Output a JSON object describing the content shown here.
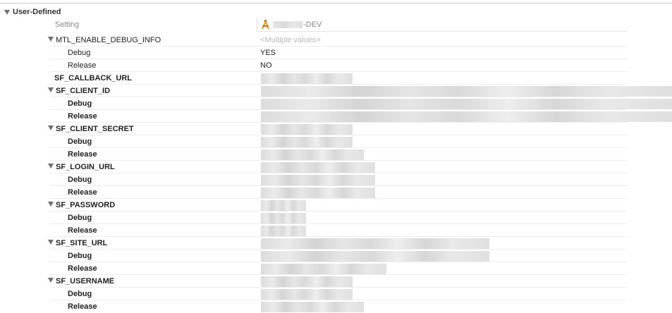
{
  "section": {
    "title": "User-Defined"
  },
  "header": {
    "setting_label": "Setting",
    "target_suffix": "-DEV"
  },
  "rows": [
    {
      "label": "MTL_ENABLE_DEBUG_INFO",
      "value": "<Multiple values>",
      "placeholder": true
    },
    {
      "label": "Debug",
      "value": "YES"
    },
    {
      "label": "Release",
      "value": "NO"
    },
    {
      "label": "SF_CALLBACK_URL"
    },
    {
      "label": "SF_CLIENT_ID"
    },
    {
      "label": "Debug"
    },
    {
      "label": "Release"
    },
    {
      "label": "SF_CLIENT_SECRET"
    },
    {
      "label": "Debug"
    },
    {
      "label": "Release"
    },
    {
      "label": "SF_LOGIN_URL"
    },
    {
      "label": "Debug"
    },
    {
      "label": "Release"
    },
    {
      "label": "SF_PASSWORD"
    },
    {
      "label": "Debug"
    },
    {
      "label": "Release"
    },
    {
      "label": "SF_SITE_URL"
    },
    {
      "label": "Debug"
    },
    {
      "label": "Release"
    },
    {
      "label": "SF_USERNAME"
    },
    {
      "label": "Debug"
    },
    {
      "label": "Release"
    }
  ]
}
